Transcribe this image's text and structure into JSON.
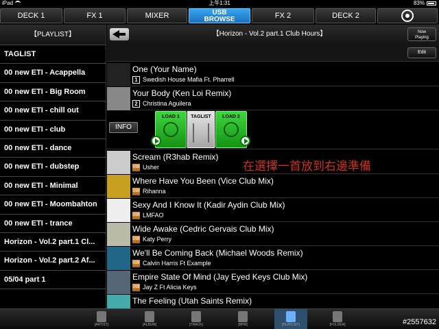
{
  "status": {
    "device": "iPad",
    "time": "上午1:31",
    "battery": "83%"
  },
  "tabs": [
    {
      "label": "DECK 1"
    },
    {
      "label": "FX 1"
    },
    {
      "label": "MIXER"
    },
    {
      "line1": "USB",
      "line2": "BROWSE"
    },
    {
      "label": "FX 2"
    },
    {
      "label": "DECK 2"
    }
  ],
  "left": {
    "header": "【PLAYLIST】",
    "items": [
      "TAGLIST",
      "00 new ETI - Acappella",
      "00 new ETI - Big Room",
      "00 new ETI - chill out",
      "00 new ETI - club",
      "00 new ETI - dance",
      "00 new ETI - dubstep",
      "00 new ETI - Minimal",
      "00 new ETI - Moombahton",
      "00 new ETI - trance",
      "Horizon - Vol.2 part.1 Cl...",
      "Horizon - Vol.2 part.2 Af...",
      "05/04 part 1"
    ]
  },
  "right": {
    "title": "【Horizon - Vol.2 part.1 Club Hours】",
    "now_playing_1": "Now",
    "now_playing_2": "Playing",
    "edit": "Edit",
    "info": "INFO",
    "load1": "LOAD 1",
    "taglist": "TAGLIST",
    "load2": "LOAD 2",
    "overlay": "在選擇一首放到右邊準備",
    "tracks": [
      {
        "title": "One (Your Name)",
        "artist": "Swedish House Mafia Ft. Pharrell",
        "deck": "1",
        "art": "#222"
      },
      {
        "title": "Your Body (Ken Loi Remix)",
        "artist": "Christina Aguilera",
        "deck": "2",
        "art": "#888"
      },
      {
        "title": "Scream (R3hab Remix)",
        "artist": "Usher",
        "art": "#ccc"
      },
      {
        "title": "Where Have You Been (Vice Club Mix)",
        "artist": "Rihanna",
        "art": "#c8a020"
      },
      {
        "title": "Sexy And I Know It (Kadir Aydin Club Mix)",
        "artist": "LMFAO",
        "art": "#eee"
      },
      {
        "title": "Wide Awake (Cedric Gervais Club Mix)",
        "artist": "Katy Perry",
        "art": "#bbbbaa"
      },
      {
        "title": "We'll Be Coming Back (Michael Woods Remix)",
        "artist": "Calvin Harris Ft Example",
        "art": "#226688"
      },
      {
        "title": "Empire State Of Mind (Jay Eyed Keys Club Mix)",
        "artist": "Jay Z Ft Alicia Keys",
        "art": "#556677"
      },
      {
        "title": "The Feeling (Utah Saints Remix)",
        "artist": "",
        "art": "#44aaaa"
      }
    ]
  },
  "bottom": {
    "artist": "[ARTIST]",
    "album": "[ALBUM]",
    "track": "[TRACK]",
    "bpm": "[BPM]",
    "playlist": "[PLAYLIST]",
    "folder": "[FOLDER]",
    "watermark": "#2557632"
  }
}
